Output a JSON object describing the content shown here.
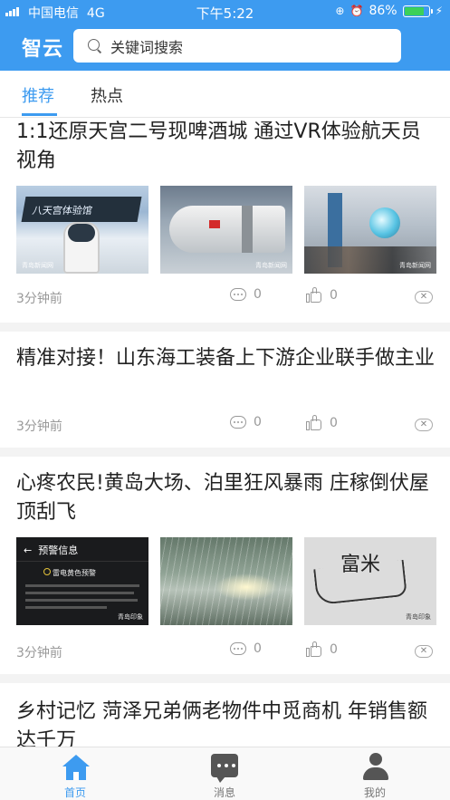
{
  "status_bar": {
    "carrier": "中国电信",
    "network": "4G",
    "time": "下午5:22",
    "battery_percent": "86%",
    "battery_level": 0.86
  },
  "header": {
    "logo": "智云",
    "search_placeholder": "关键词搜索"
  },
  "tabs": [
    {
      "label": "推荐",
      "active": true
    },
    {
      "label": "热点",
      "active": false
    }
  ],
  "articles": [
    {
      "title": "1:1还原天宫二号现啤酒城 通过VR体验航天员视角",
      "time_ago": "3分钟前",
      "comments": "0",
      "likes": "0",
      "thumbnails": [
        {
          "sign_text": "八天宫体验馆",
          "watermark": "青岛新闻网"
        },
        {
          "watermark": "青岛新闻网"
        },
        {
          "watermark": "青岛新闻网"
        }
      ]
    },
    {
      "title": "精准对接！山东海工装备上下游企业联手做主业",
      "time_ago": "3分钟前",
      "comments": "0",
      "likes": "0",
      "thumbnails": []
    },
    {
      "title": "心疼农民!黄岛大场、泊里狂风暴雨 庄稼倒伏屋顶刮飞",
      "time_ago": "3分钟前",
      "comments": "0",
      "likes": "0",
      "thumbnails": [
        {
          "header": "预警信息",
          "alert": "雷电黄色预警",
          "watermark": "青岛印象"
        },
        {},
        {
          "scribble": "富米",
          "watermark": "青岛印象"
        }
      ]
    },
    {
      "title": "乡村记忆 菏泽兄弟俩老物件中觅商机 年销售额达千万"
    }
  ],
  "bottom_nav": [
    {
      "label": "首页",
      "icon": "home-icon",
      "active": true
    },
    {
      "label": "消息",
      "icon": "message-icon",
      "active": false
    },
    {
      "label": "我的",
      "icon": "profile-icon",
      "active": false
    }
  ],
  "colors": {
    "brand": "#3d9bf0",
    "battery_fill": "#3cd05a"
  }
}
